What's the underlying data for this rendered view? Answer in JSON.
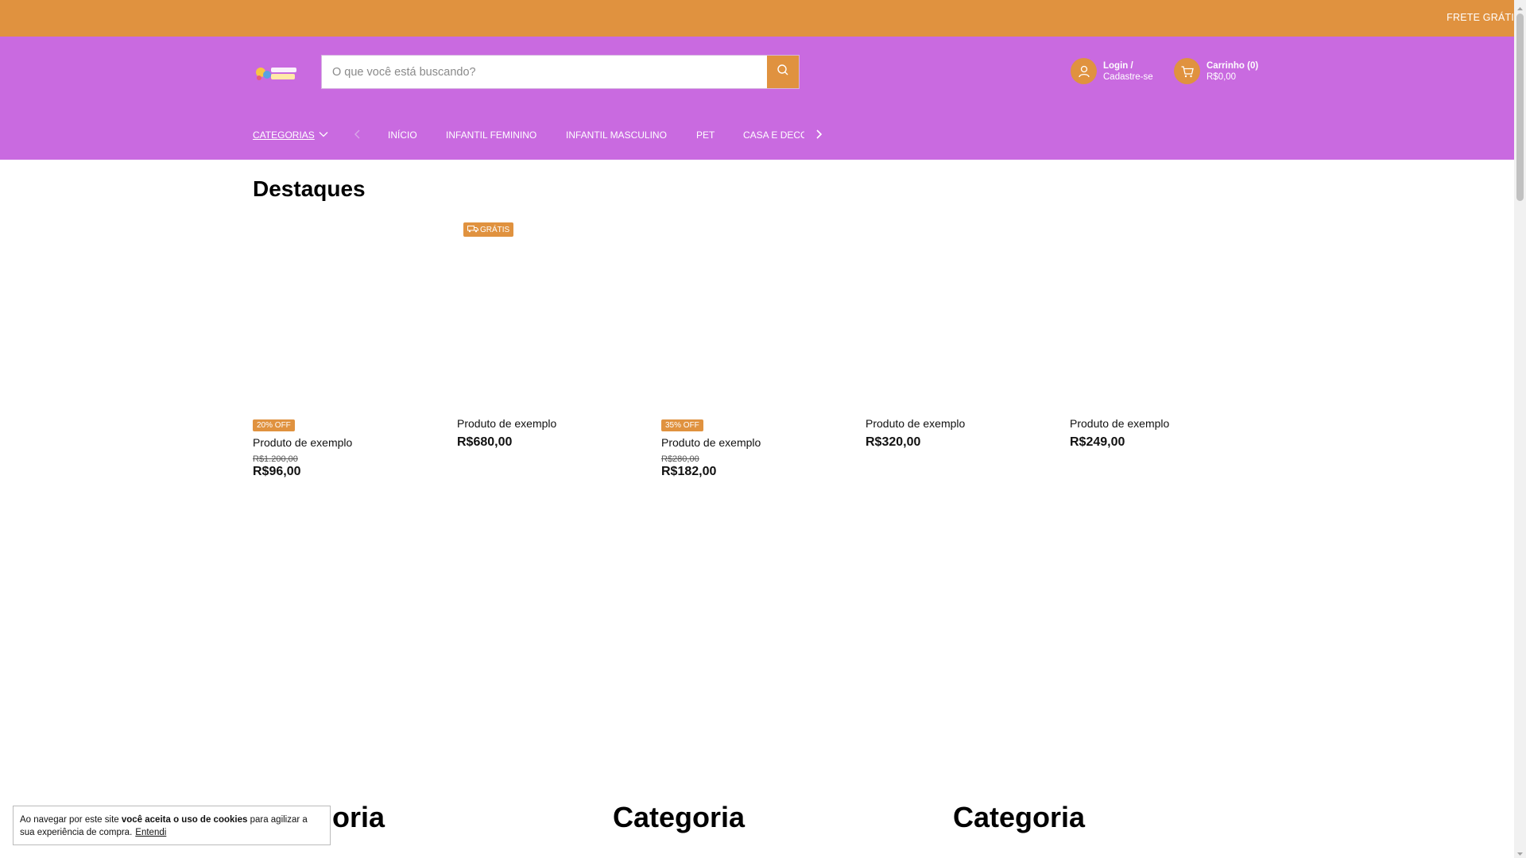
{
  "topbar": {
    "promo": "FRETE GRÁTI"
  },
  "header": {
    "logo_name": "store-logo",
    "search": {
      "placeholder": "O que você está buscando?"
    },
    "account": {
      "line1": "Login /",
      "line2": "Cadastre-se"
    },
    "cart": {
      "line1": "Carrinho (0)",
      "line2": "R$0,00"
    }
  },
  "nav": {
    "categories_label": "CATEGORIAS",
    "items": [
      "INÍCIO",
      "INFANTIL FEMININO",
      "INFANTIL MASCULINO",
      "PET",
      "CASA E DECOR"
    ]
  },
  "highlights": {
    "title": "Destaques",
    "products": [
      {
        "badge": "20% OFF",
        "name": "Produto de exemplo",
        "old_price": "R$1.200,00",
        "price": "R$96,00"
      },
      {
        "ship_badge": "GRÁTIS",
        "name": "Produto de exemplo",
        "price": "R$680,00"
      },
      {
        "badge": "35% OFF",
        "name": "Produto de exemplo",
        "old_price": "R$280,00",
        "price": "R$182,00"
      },
      {
        "name": "Produto de exemplo",
        "price": "R$320,00"
      },
      {
        "name": "Produto de exemplo",
        "price": "R$249,00"
      }
    ]
  },
  "categories": [
    "Categoria",
    "Categoria",
    "Categoria"
  ],
  "cookie": {
    "prefix": "Ao navegar por este site ",
    "bold": "você aceita o uso de cookies",
    "suffix": " para agilizar a sua experiência de compra.",
    "button": "Entendi"
  },
  "colors": {
    "topbar": "#e0923f",
    "header": "#c96ae0",
    "accent": "#e0923f"
  }
}
